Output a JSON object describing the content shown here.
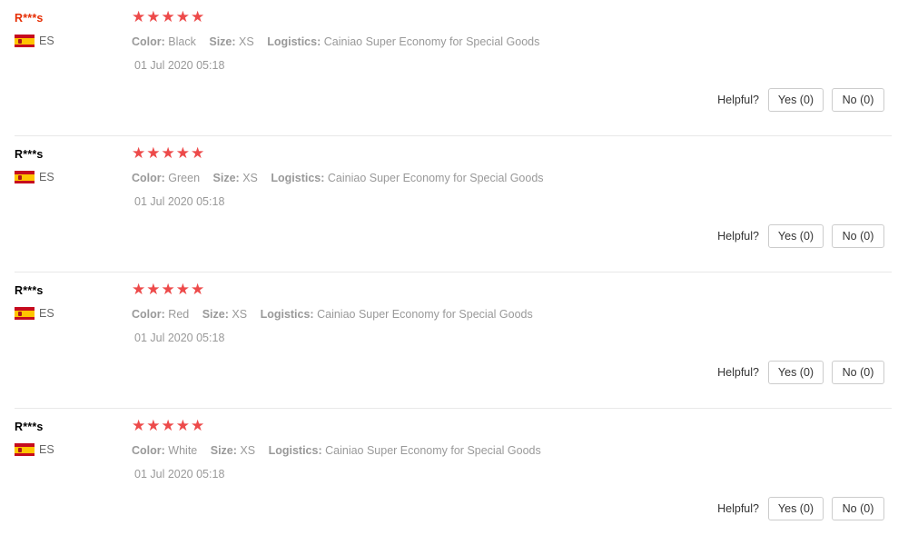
{
  "colors": {
    "star": "#ed4a4a",
    "highlighted_user": "#e62e04",
    "muted_text": "#999999",
    "divider": "#e8e8e8"
  },
  "helpful_label": "Helpful?",
  "reviews": [
    {
      "user": "R***s",
      "user_highlighted": true,
      "flag_icon": "spain-flag-icon",
      "country": "ES",
      "rating": 5,
      "stars": [
        "★",
        "★",
        "★",
        "★",
        "★"
      ],
      "attributes": [
        {
          "key": "Color:",
          "value": "Black"
        },
        {
          "key": "Size:",
          "value": "XS"
        },
        {
          "key": "Logistics:",
          "value": "Cainiao Super Economy for Special Goods"
        }
      ],
      "date": "01 Jul 2020 05:18",
      "yes_label": "Yes (0)",
      "no_label": "No (0)"
    },
    {
      "user": "R***s",
      "user_highlighted": false,
      "flag_icon": "spain-flag-icon",
      "country": "ES",
      "rating": 5,
      "stars": [
        "★",
        "★",
        "★",
        "★",
        "★"
      ],
      "attributes": [
        {
          "key": "Color:",
          "value": "Green"
        },
        {
          "key": "Size:",
          "value": "XS"
        },
        {
          "key": "Logistics:",
          "value": "Cainiao Super Economy for Special Goods"
        }
      ],
      "date": "01 Jul 2020 05:18",
      "yes_label": "Yes (0)",
      "no_label": "No (0)"
    },
    {
      "user": "R***s",
      "user_highlighted": false,
      "flag_icon": "spain-flag-icon",
      "country": "ES",
      "rating": 5,
      "stars": [
        "★",
        "★",
        "★",
        "★",
        "★"
      ],
      "attributes": [
        {
          "key": "Color:",
          "value": "Red"
        },
        {
          "key": "Size:",
          "value": "XS"
        },
        {
          "key": "Logistics:",
          "value": "Cainiao Super Economy for Special Goods"
        }
      ],
      "date": "01 Jul 2020 05:18",
      "yes_label": "Yes (0)",
      "no_label": "No (0)"
    },
    {
      "user": "R***s",
      "user_highlighted": false,
      "flag_icon": "spain-flag-icon",
      "country": "ES",
      "rating": 5,
      "stars": [
        "★",
        "★",
        "★",
        "★",
        "★"
      ],
      "attributes": [
        {
          "key": "Color:",
          "value": "White"
        },
        {
          "key": "Size:",
          "value": "XS"
        },
        {
          "key": "Logistics:",
          "value": "Cainiao Super Economy for Special Goods"
        }
      ],
      "date": "01 Jul 2020 05:18",
      "yes_label": "Yes (0)",
      "no_label": "No (0)"
    }
  ]
}
